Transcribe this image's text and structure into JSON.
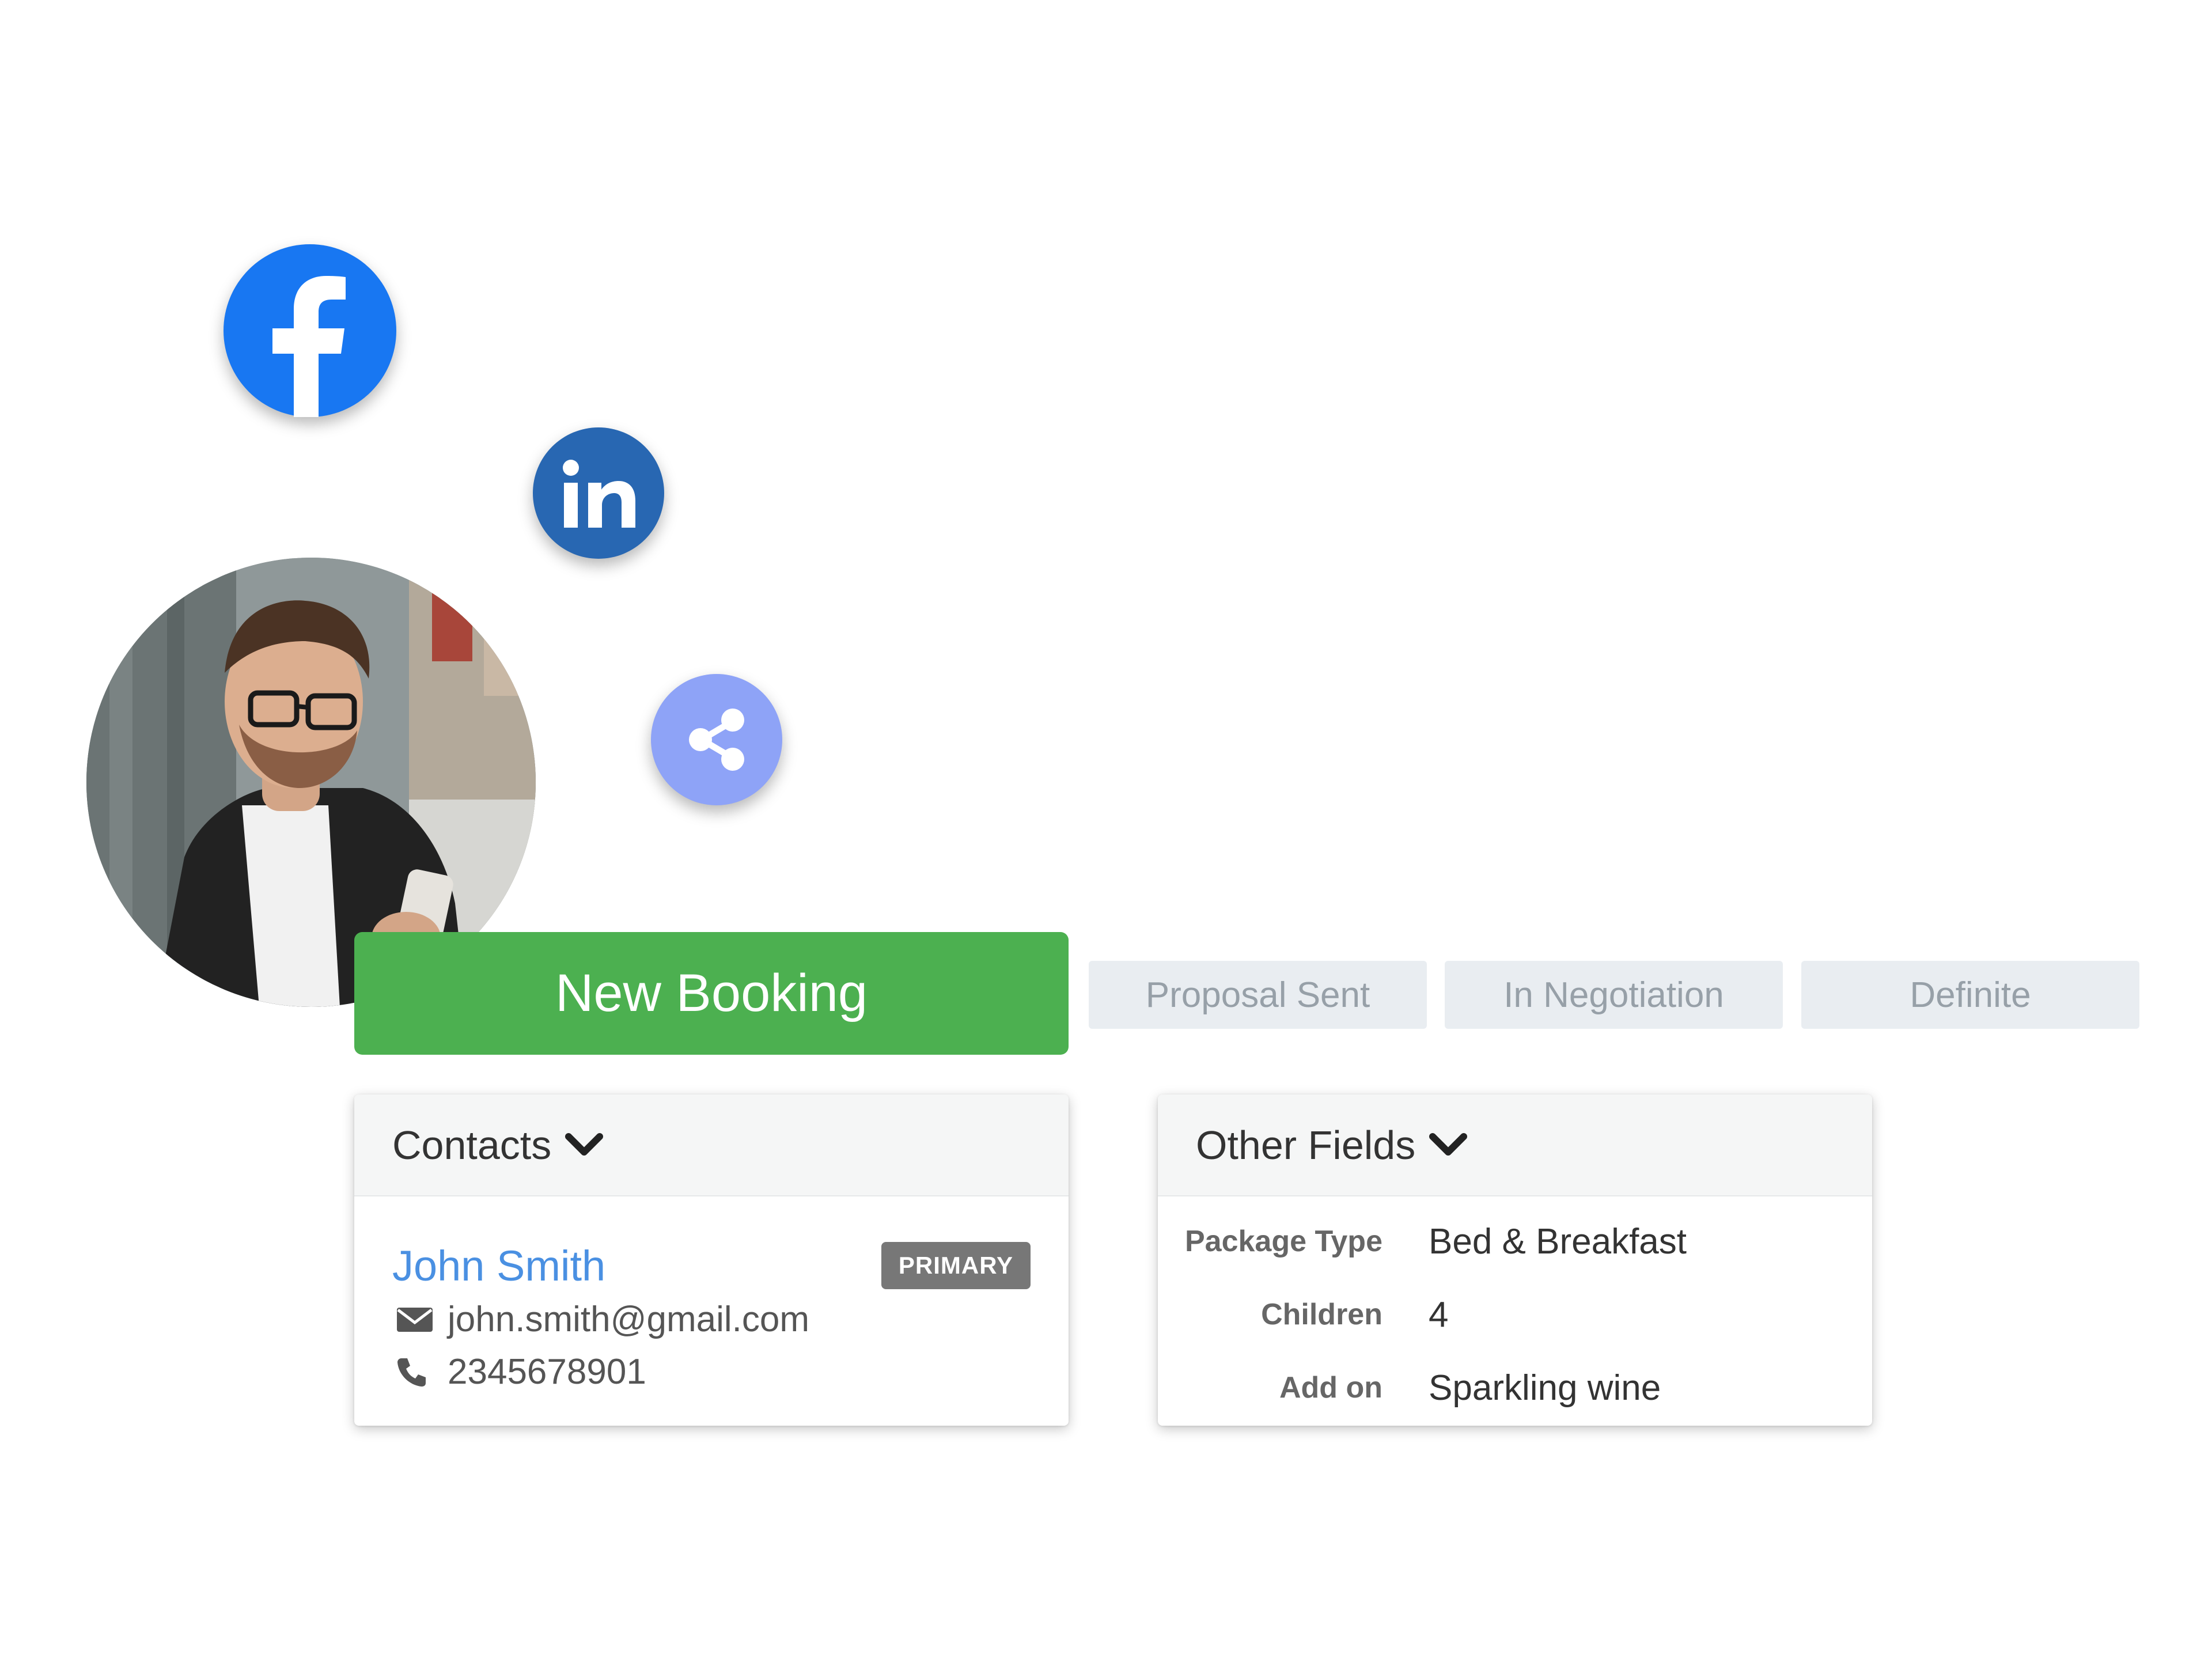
{
  "social": {
    "facebook_icon": "facebook-icon",
    "linkedin_icon": "linkedin-icon",
    "share_icon": "share-icon",
    "linkedin_text": "in"
  },
  "pipeline": {
    "stages": [
      "New Booking",
      "Proposal Sent",
      "In Negotiation",
      "Definite"
    ],
    "active_color": "#4cb050",
    "inactive_color": "#e9edf1"
  },
  "contacts": {
    "title": "Contacts",
    "name": "John Smith",
    "badge": "PRIMARY",
    "email": "john.smith@gmail.com",
    "phone": "2345678901"
  },
  "other_fields": {
    "title": "Other Fields",
    "rows": [
      {
        "label": "Package Type",
        "value": "Bed & Breakfast"
      },
      {
        "label": "Children",
        "value": "4"
      },
      {
        "label": "Add on",
        "value": "Sparkling wine"
      }
    ]
  }
}
